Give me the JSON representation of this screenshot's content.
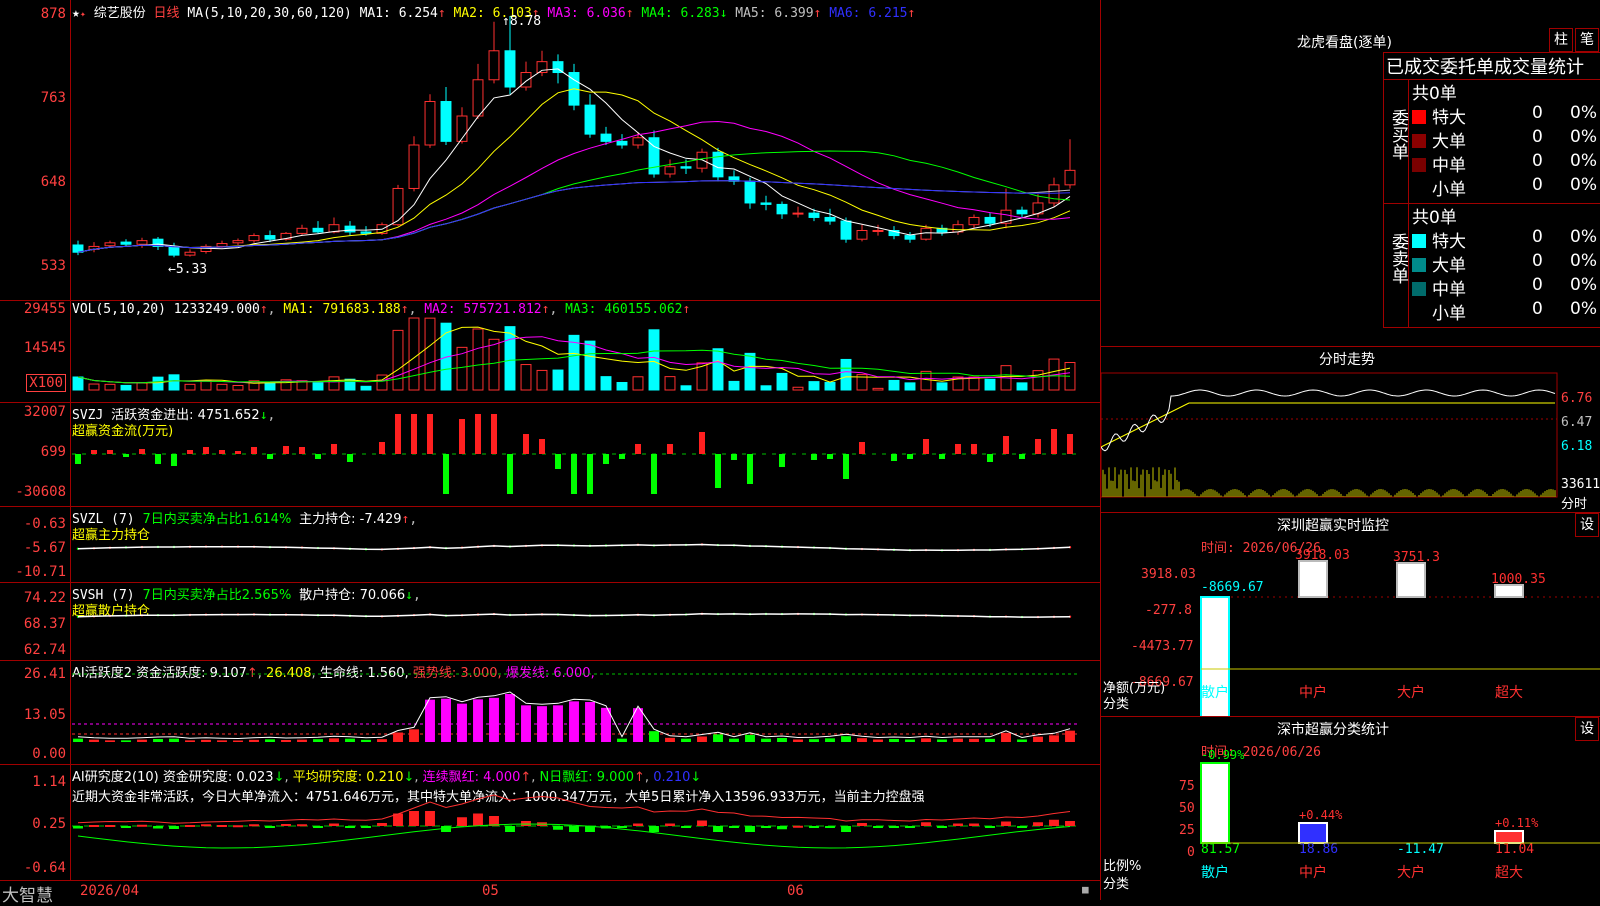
{
  "chart_header": {
    "stock": "综艺股份",
    "period": "日线",
    "ma_params": "MA(5,10,20,30,60,120)",
    "ma": [
      {
        "label": "MA1:",
        "value": "6.254",
        "arrow": "↑",
        "color": "#ffffff"
      },
      {
        "label": "MA2:",
        "value": "6.103",
        "arrow": "↑",
        "color": "#ffff00"
      },
      {
        "label": "MA3:",
        "value": "6.036",
        "arrow": "↑",
        "color": "#ff00ff"
      },
      {
        "label": "MA4:",
        "value": "6.283",
        "arrow": "↓",
        "color": "#00ff00"
      },
      {
        "label": "MA5:",
        "value": "6.399",
        "arrow": "↑",
        "color": "#c0c0c0"
      },
      {
        "label": "MA6:",
        "value": "6.215",
        "arrow": "↑",
        "color": "#3030ff"
      }
    ],
    "high_label": "8.78",
    "low_label": "5.33"
  },
  "price_axis": [
    "878",
    "763",
    "648",
    "533"
  ],
  "vol_panel": {
    "title": "VOL(5,10,20)",
    "value": "1233249.000",
    "ma1": "MA1: 791683.188",
    "ma2": "MA2: 575721.812",
    "ma3": "MA3: 460155.062",
    "axis": [
      "29455",
      "14545",
      "X100"
    ]
  },
  "svzj_panel": {
    "title": "SVZJ",
    "label": "活跃资金进出: 4751.652",
    "subtitle": "超赢资金流(万元)",
    "axis": [
      "32007",
      "699",
      "-30608"
    ]
  },
  "svzl_panel": {
    "title": "SVZL (7)",
    "label_green": "7日内买卖净占比1.614%",
    "label_white": "主力持仓: -7.429",
    "subtitle": "超赢主力持仓",
    "axis": [
      "-0.63",
      "-5.67",
      "-10.71"
    ]
  },
  "svsh_panel": {
    "title": "SVSH (7)",
    "label_green": "7日内买卖净占比2.565%",
    "label_white": "散户持仓: 70.066",
    "subtitle": "超赢散户持仓",
    "axis": [
      "74.22",
      "68.37",
      "62.74"
    ]
  },
  "ai2_panel": {
    "title": "AI活跃度2",
    "label": "资金活跃度: 9.107",
    "v2": "26.408",
    "life": "生命线: 1.560,",
    "strong": "强势线: 3.000,",
    "burst": "爆发线: 6.000,",
    "axis": [
      "26.41",
      "13.05",
      "0.00"
    ]
  },
  "ai_research": {
    "title": "AI研究度2(10)",
    "a": "资金研究度: 0.023",
    "b": "平均研究度: 0.210",
    "c": "连续飘红: 4.000",
    "d": "N日飘红: 9.000",
    "e": "0.210",
    "text": "近期大资金非常活跃，今日大单净流入：4751.646万元，其中特大单净流入：1000.347万元，大单5日累计净入13596.933万元，当前主力控盘强",
    "axis": [
      "1.14",
      "0.25",
      "-0.64"
    ]
  },
  "dates": [
    "2026/04",
    "05",
    "06"
  ],
  "brand": "大智慧",
  "right": {
    "title": "龙虎看盘(逐单)",
    "btn_a": "柱",
    "btn_b": "笔",
    "tabs": "已成交委托单成交量统计",
    "buy_side": "委买单",
    "sell_side": "委卖单",
    "buy_total": "共0单",
    "sell_total": "共0单",
    "rows": [
      "特大",
      "大单",
      "中单",
      "小单"
    ],
    "zero": "0",
    "pct": "0%",
    "buy_colors": [
      "#ff0000",
      "#8b0000",
      "#7a0000",
      "#000000"
    ],
    "sell_colors": [
      "#00ffff",
      "#008b8b",
      "#006b6b",
      "#000000"
    ],
    "fs_title": "分时走势",
    "fs_axis": [
      "6.76",
      "6.47",
      "6.18",
      "33611",
      "分时"
    ],
    "sz_title": "深圳超赢实时监控",
    "sz_btn": "设",
    "sz_time": "时间: 2026/06/26",
    "sz_axis": [
      "3918.03",
      "-277.8",
      "-4473.77",
      "-8669.67"
    ],
    "sz_net": "净额(万元)",
    "sz_cls": "分类",
    "sz_cats": [
      "散户",
      "中户",
      "大户",
      "超大"
    ],
    "sz_vals": [
      "-8669.67",
      "3918.03",
      "3751.3",
      "1000.35"
    ],
    "cls_title": "深市超赢分类统计",
    "cls_btn": "设",
    "cls_time": "时间: 2026/06/26",
    "cls_axis": [
      "75",
      "50",
      "25",
      "0"
    ],
    "cls_ratio": "比例%",
    "cls_cls": "分类",
    "cls_pct": [
      "-0.99%",
      "+0.44%",
      "+0.11%"
    ],
    "cls_vals": [
      "81.57",
      "18.86",
      "-11.47",
      "11.04"
    ],
    "cls_cats": [
      "散户",
      "中户",
      "大户",
      "超大"
    ]
  },
  "chart_data": {
    "type": "candlestick",
    "candles": [
      [
        562,
        552,
        568,
        548
      ],
      [
        556,
        560,
        566,
        552
      ],
      [
        561,
        565,
        568,
        558
      ],
      [
        566,
        563,
        570,
        560
      ],
      [
        563,
        568,
        572,
        558
      ],
      [
        570,
        560,
        573,
        555
      ],
      [
        560,
        548,
        565,
        545
      ],
      [
        548,
        552,
        556,
        546
      ],
      [
        553,
        560,
        563,
        550
      ],
      [
        560,
        564,
        568,
        558
      ],
      [
        565,
        568,
        571,
        562
      ],
      [
        568,
        575,
        578,
        565
      ],
      [
        575,
        570,
        582,
        566
      ],
      [
        570,
        578,
        580,
        568
      ],
      [
        578,
        585,
        590,
        576
      ],
      [
        585,
        580,
        595,
        578
      ],
      [
        580,
        590,
        600,
        578
      ],
      [
        588,
        580,
        595,
        575
      ],
      [
        580,
        578,
        588,
        575
      ],
      [
        578,
        590,
        593,
        576
      ],
      [
        590,
        640,
        645,
        588
      ],
      [
        640,
        700,
        712,
        636
      ],
      [
        700,
        760,
        770,
        696
      ],
      [
        760,
        705,
        780,
        700
      ],
      [
        705,
        740,
        752,
        702
      ],
      [
        740,
        790,
        812,
        736
      ],
      [
        790,
        830,
        870,
        785
      ],
      [
        830,
        780,
        878,
        770
      ],
      [
        780,
        800,
        815,
        775
      ],
      [
        800,
        815,
        830,
        795
      ],
      [
        815,
        800,
        825,
        785
      ],
      [
        800,
        755,
        812,
        748
      ],
      [
        755,
        715,
        770,
        710
      ],
      [
        715,
        705,
        725,
        700
      ],
      [
        705,
        700,
        715,
        695
      ],
      [
        700,
        710,
        718,
        695
      ],
      [
        710,
        660,
        720,
        655
      ],
      [
        660,
        670,
        680,
        655
      ],
      [
        670,
        668,
        680,
        660
      ],
      [
        668,
        690,
        695,
        662
      ],
      [
        690,
        656,
        696,
        650
      ],
      [
        656,
        650,
        665,
        645
      ],
      [
        650,
        620,
        655,
        612
      ],
      [
        620,
        618,
        630,
        610
      ],
      [
        618,
        605,
        622,
        598
      ],
      [
        605,
        606,
        615,
        600
      ],
      [
        606,
        600,
        612,
        595
      ],
      [
        600,
        595,
        612,
        590
      ],
      [
        595,
        570,
        600,
        565
      ],
      [
        570,
        582,
        590,
        567
      ],
      [
        582,
        582,
        590,
        575
      ],
      [
        582,
        575,
        588,
        570
      ],
      [
        575,
        570,
        580,
        565
      ],
      [
        570,
        585,
        590,
        568
      ],
      [
        585,
        580,
        590,
        575
      ],
      [
        580,
        590,
        596,
        576
      ],
      [
        590,
        600,
        604,
        585
      ],
      [
        600,
        592,
        606,
        587
      ],
      [
        592,
        610,
        640,
        585
      ],
      [
        610,
        605,
        615,
        600
      ],
      [
        605,
        620,
        632,
        600
      ],
      [
        620,
        645,
        655,
        615
      ],
      [
        645,
        665,
        708,
        640
      ]
    ]
  }
}
